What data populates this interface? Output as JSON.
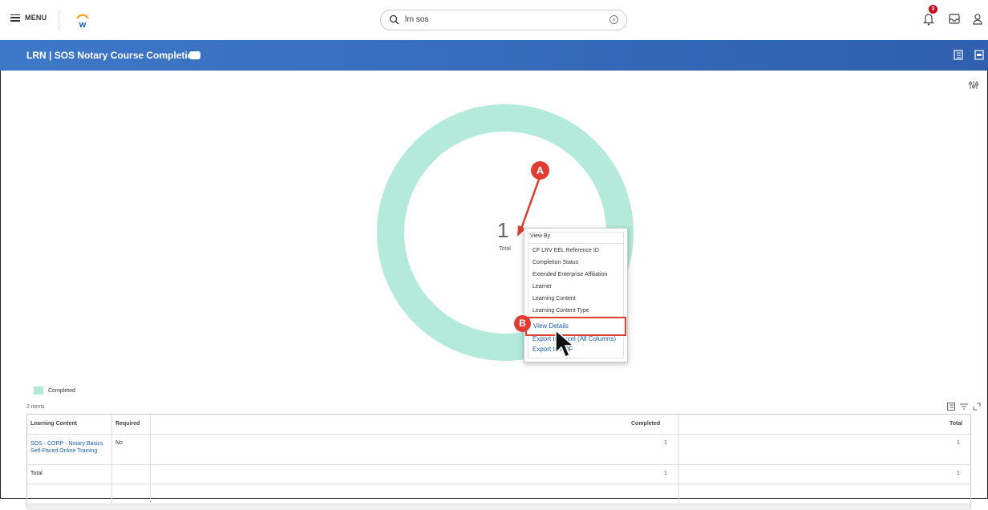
{
  "topbar": {
    "menu_label": "MENU",
    "search_value": "lrn sos",
    "notification_count": "3"
  },
  "header": {
    "title": "LRN | SOS Notary Course Completion"
  },
  "chart_data": {
    "type": "pie",
    "categories": [
      "Completed"
    ],
    "values": [
      1
    ],
    "center_value": "1",
    "center_label": "Total",
    "legend": [
      "Completed"
    ],
    "colors": [
      "#b3ead9"
    ]
  },
  "annotations": {
    "a": "A",
    "b": "B"
  },
  "popup": {
    "header": "View By",
    "items": [
      "CF LRV EEL Reference ID",
      "Completion Status",
      "Extended Enterprise Affiliation",
      "Learner",
      "Learning Content",
      "Learning Content Type"
    ],
    "actions": [
      "View Details",
      "Export to Excel (All Columns)",
      "Export to PDF"
    ]
  },
  "legend": {
    "label": "Completed"
  },
  "table": {
    "count": "2 items",
    "headers": [
      "Learning Content",
      "Required",
      "Completed",
      "Total"
    ],
    "rows": [
      [
        "SOS - CORP - Notary Basics Self-Paced Online Training",
        "No",
        "1",
        "1"
      ],
      [
        "Total",
        "",
        "1",
        "1"
      ]
    ]
  }
}
